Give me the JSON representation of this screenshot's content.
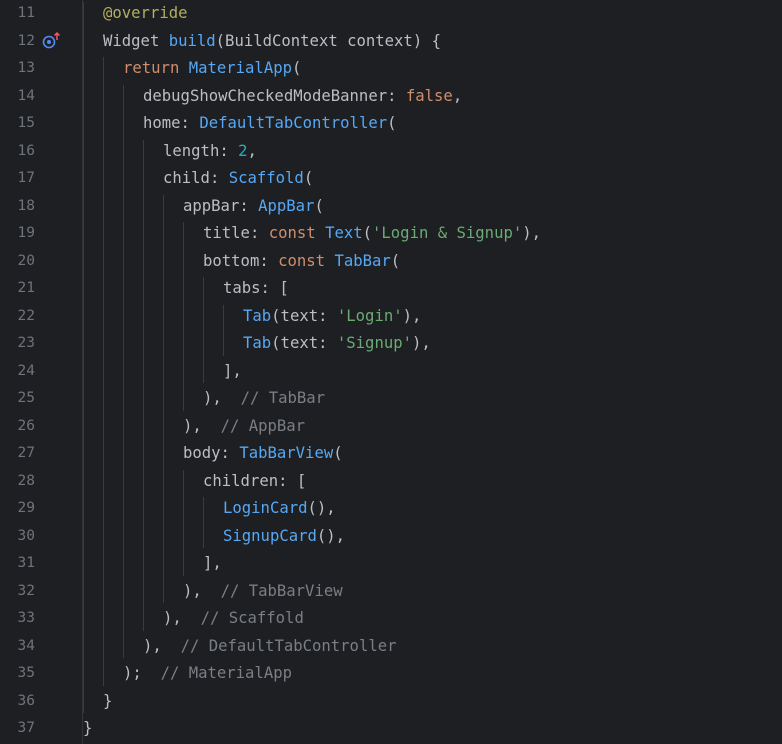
{
  "editor": {
    "theme": {
      "background": "#1e1f22",
      "line_number": "#6f737a",
      "default": "#bcbec4",
      "keyword": "#cf8e6d",
      "type": "#56a8f5",
      "string": "#6aab73",
      "number": "#2aacb8",
      "annotation": "#b3ae60",
      "comment": "#7a7e85"
    },
    "gutter_icon": "override-method-icon",
    "lines": [
      {
        "n": "11",
        "indent": 1,
        "tokens": [
          [
            "an",
            "@override"
          ]
        ]
      },
      {
        "n": "12",
        "indent": 1,
        "icon": true,
        "tokens": [
          [
            "",
            "Widget "
          ],
          [
            "ty",
            "build"
          ],
          [
            "",
            "(BuildContext context) {"
          ]
        ]
      },
      {
        "n": "13",
        "indent": 2,
        "tokens": [
          [
            "kw",
            "return "
          ],
          [
            "ty",
            "MaterialApp"
          ],
          [
            "",
            "("
          ]
        ]
      },
      {
        "n": "14",
        "indent": 3,
        "tokens": [
          [
            "",
            "debugShowCheckedModeBanner: "
          ],
          [
            "kw",
            "false"
          ],
          [
            "",
            ","
          ]
        ]
      },
      {
        "n": "15",
        "indent": 3,
        "tokens": [
          [
            "",
            "home: "
          ],
          [
            "ty",
            "DefaultTabController"
          ],
          [
            "",
            "("
          ]
        ]
      },
      {
        "n": "16",
        "indent": 4,
        "tokens": [
          [
            "",
            "length: "
          ],
          [
            "nu",
            "2"
          ],
          [
            "",
            ","
          ]
        ]
      },
      {
        "n": "17",
        "indent": 4,
        "tokens": [
          [
            "",
            "child: "
          ],
          [
            "ty",
            "Scaffold"
          ],
          [
            "",
            "("
          ]
        ]
      },
      {
        "n": "18",
        "indent": 5,
        "tokens": [
          [
            "",
            "appBar: "
          ],
          [
            "ty",
            "AppBar"
          ],
          [
            "",
            "("
          ]
        ]
      },
      {
        "n": "19",
        "indent": 6,
        "tokens": [
          [
            "",
            "title: "
          ],
          [
            "kw",
            "const "
          ],
          [
            "ty",
            "Text"
          ],
          [
            "",
            "("
          ],
          [
            "st",
            "'Login & Signup'"
          ],
          [
            "",
            "),"
          ]
        ]
      },
      {
        "n": "20",
        "indent": 6,
        "tokens": [
          [
            "",
            "bottom: "
          ],
          [
            "kw",
            "const "
          ],
          [
            "ty",
            "TabBar"
          ],
          [
            "",
            "("
          ]
        ]
      },
      {
        "n": "21",
        "indent": 7,
        "tokens": [
          [
            "",
            "tabs: ["
          ]
        ]
      },
      {
        "n": "22",
        "indent": 8,
        "tokens": [
          [
            "ty",
            "Tab"
          ],
          [
            "",
            "(text: "
          ],
          [
            "st",
            "'Login'"
          ],
          [
            "",
            "),"
          ]
        ]
      },
      {
        "n": "23",
        "indent": 8,
        "tokens": [
          [
            "ty",
            "Tab"
          ],
          [
            "",
            "(text: "
          ],
          [
            "st",
            "'Signup'"
          ],
          [
            "",
            "),"
          ]
        ]
      },
      {
        "n": "24",
        "indent": 7,
        "tokens": [
          [
            "",
            "],"
          ]
        ]
      },
      {
        "n": "25",
        "indent": 6,
        "tokens": [
          [
            "",
            "),  "
          ],
          [
            "cm",
            "// TabBar"
          ]
        ]
      },
      {
        "n": "26",
        "indent": 5,
        "tokens": [
          [
            "",
            "),  "
          ],
          [
            "cm",
            "// AppBar"
          ]
        ]
      },
      {
        "n": "27",
        "indent": 5,
        "tokens": [
          [
            "",
            "body: "
          ],
          [
            "ty",
            "TabBarView"
          ],
          [
            "",
            "("
          ]
        ]
      },
      {
        "n": "28",
        "indent": 6,
        "tokens": [
          [
            "",
            "children: ["
          ]
        ]
      },
      {
        "n": "29",
        "indent": 7,
        "tokens": [
          [
            "ty",
            "LoginCard"
          ],
          [
            "",
            "(),"
          ]
        ]
      },
      {
        "n": "30",
        "indent": 7,
        "tokens": [
          [
            "ty",
            "SignupCard"
          ],
          [
            "",
            "(),"
          ]
        ]
      },
      {
        "n": "31",
        "indent": 6,
        "tokens": [
          [
            "",
            "],"
          ]
        ]
      },
      {
        "n": "32",
        "indent": 5,
        "tokens": [
          [
            "",
            "),  "
          ],
          [
            "cm",
            "// TabBarView"
          ]
        ]
      },
      {
        "n": "33",
        "indent": 4,
        "tokens": [
          [
            "",
            "),  "
          ],
          [
            "cm",
            "// Scaffold"
          ]
        ]
      },
      {
        "n": "34",
        "indent": 3,
        "tokens": [
          [
            "",
            "),  "
          ],
          [
            "cm",
            "// DefaultTabController"
          ]
        ]
      },
      {
        "n": "35",
        "indent": 2,
        "tokens": [
          [
            "",
            ");  "
          ],
          [
            "cm",
            "// MaterialApp"
          ]
        ]
      },
      {
        "n": "36",
        "indent": 1,
        "tokens": [
          [
            "",
            "}"
          ]
        ]
      },
      {
        "n": "37",
        "indent": 0,
        "tokens": [
          [
            "",
            "}"
          ]
        ]
      }
    ]
  }
}
